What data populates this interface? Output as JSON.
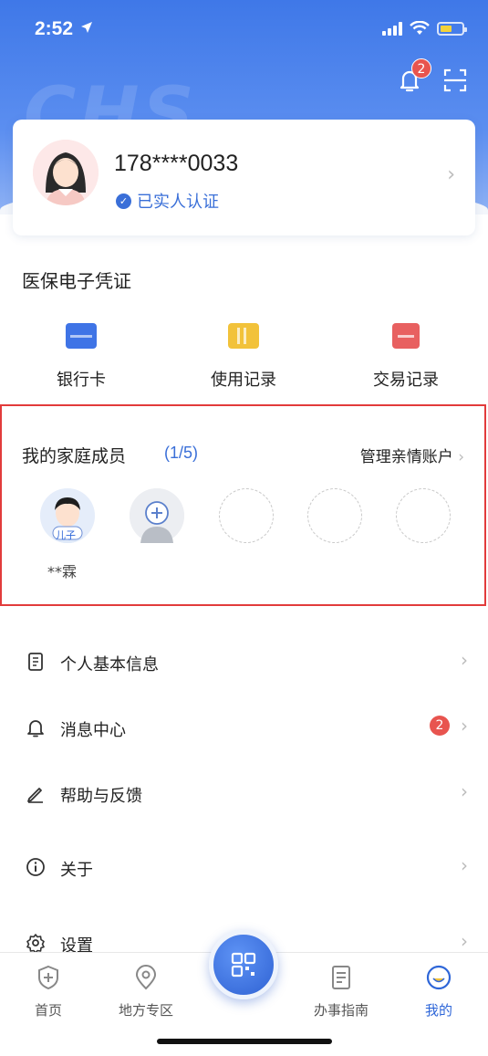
{
  "status_bar": {
    "time": "2:52"
  },
  "header": {
    "notification_count": "2",
    "watermark": "CHS"
  },
  "profile": {
    "phone": "178****0033",
    "verified_label": "已实人认证"
  },
  "credentials": {
    "title": "医保电子凭证",
    "items": [
      {
        "label": "银行卡",
        "icon": "bank-card-icon",
        "color": "#3f74e6"
      },
      {
        "label": "使用记录",
        "icon": "record-icon",
        "color": "#f2c23a"
      },
      {
        "label": "交易记录",
        "icon": "transaction-icon",
        "color": "#e86060"
      }
    ]
  },
  "family": {
    "title": "我的家庭成员",
    "count": "(1/5)",
    "manage_label": "管理亲情账户",
    "members": [
      {
        "name": "**霖",
        "relation": "儿子"
      }
    ]
  },
  "menu": [
    {
      "label": "个人基本信息",
      "icon": "document-icon"
    },
    {
      "label": "消息中心",
      "icon": "bell-icon",
      "badge": "2"
    },
    {
      "label": "帮助与反馈",
      "icon": "pen-icon"
    },
    {
      "label": "关于",
      "icon": "info-icon"
    },
    {
      "label": "设置",
      "icon": "gear-icon"
    }
  ],
  "tabbar": [
    {
      "label": "首页",
      "icon": "shield-icon"
    },
    {
      "label": "地方专区",
      "icon": "location-icon"
    },
    {
      "label": "办事指南",
      "icon": "guide-icon"
    },
    {
      "label": "我的",
      "icon": "me-icon",
      "active": true
    }
  ],
  "colors": {
    "accent": "#2e66d8",
    "badge": "#e8544f",
    "highlight_border": "#e23b3b"
  }
}
